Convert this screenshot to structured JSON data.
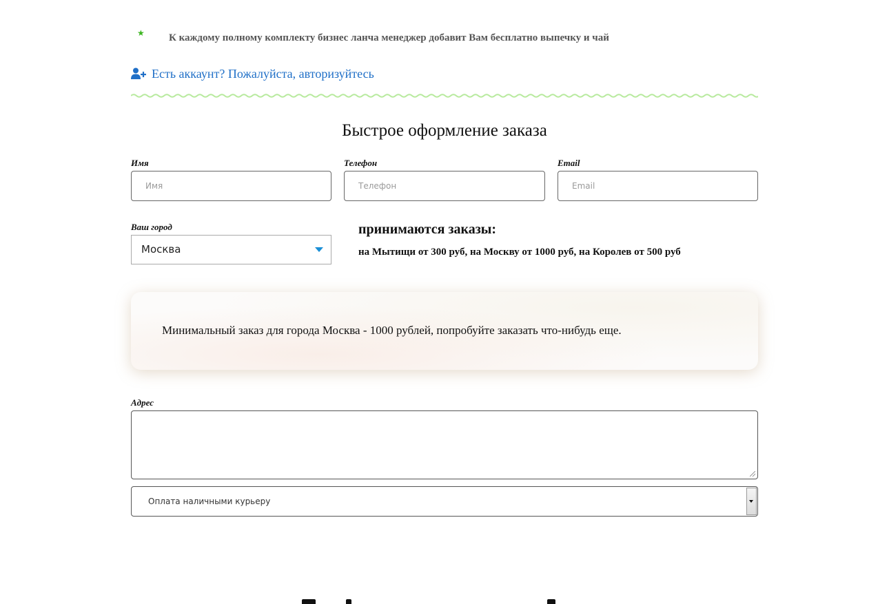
{
  "notice": {
    "icon": "star-icon",
    "text": "К каждому полному комплекту бизнес ланча менеджер добавит Вам бесплатно выпечку и чай"
  },
  "login": {
    "icon": "user-plus-icon",
    "text": "Есть аккаунт? Пожалуйста, авторизуйтесь"
  },
  "form": {
    "title": "Быстрое оформление заказа",
    "name": {
      "label": "Имя",
      "placeholder": "Имя",
      "value": ""
    },
    "phone": {
      "label": "Телефон",
      "placeholder": "Телефон",
      "value": ""
    },
    "email": {
      "label": "Email",
      "placeholder": "Email",
      "value": ""
    },
    "city": {
      "label": "Ваш город",
      "selected": "Москва"
    },
    "orders": {
      "heading": "принимаются заказы:",
      "detail": "на Мытищи от 300 руб, на Москву от 1000 руб, на Королев от 500 руб"
    },
    "min_order_message": "Минимальный заказ для города Москва - 1000 рублей, попробуйте заказать что-нибудь еще.",
    "address": {
      "label": "Адрес",
      "value": ""
    },
    "payment": {
      "selected": "Оплата наличными курьеру"
    }
  },
  "colors": {
    "link": "#1f6fc7",
    "star": "#3cb521",
    "wave": "#b8ea9e",
    "caret": "#1a8fd6"
  }
}
